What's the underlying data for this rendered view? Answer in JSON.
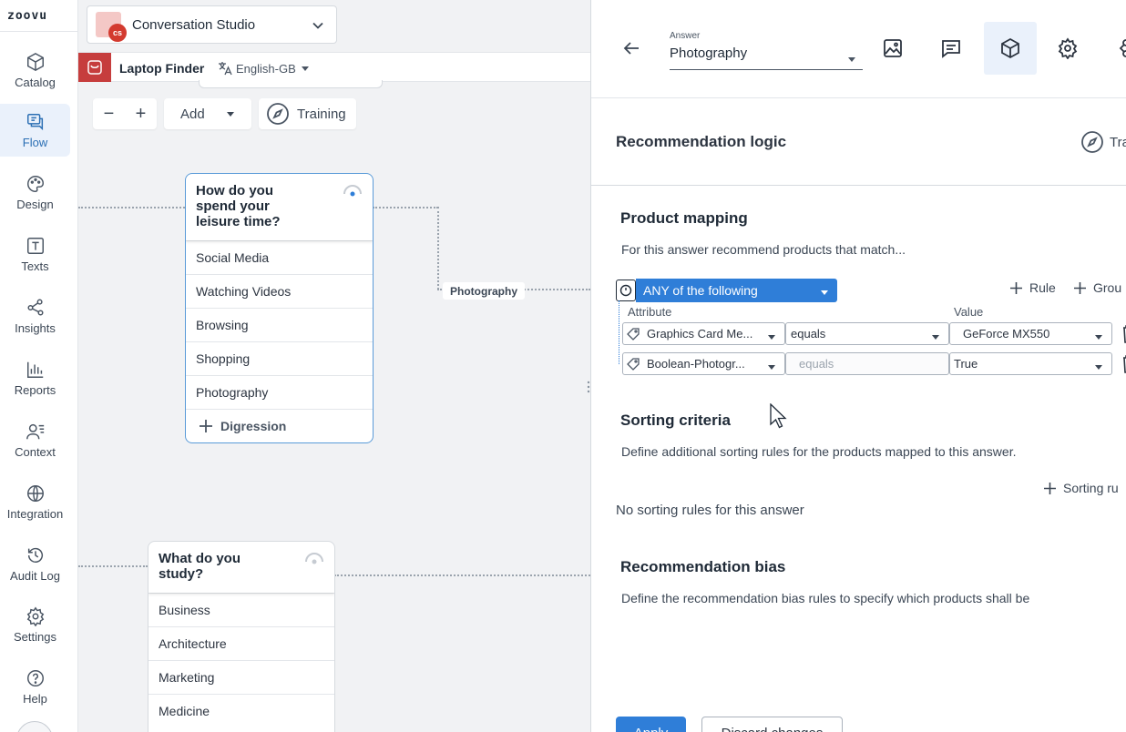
{
  "nav": {
    "logo": "zoovu",
    "items": [
      {
        "label": "Catalog",
        "icon": "cube-icon"
      },
      {
        "label": "Flow",
        "icon": "flow-icon",
        "active": true
      },
      {
        "label": "Design",
        "icon": "palette-icon"
      },
      {
        "label": "Texts",
        "icon": "text-icon"
      },
      {
        "label": "Insights",
        "icon": "share-nodes-icon"
      },
      {
        "label": "Reports",
        "icon": "bar-chart-icon"
      },
      {
        "label": "Context",
        "icon": "user-list-icon"
      },
      {
        "label": "Integration",
        "icon": "globe-icon"
      },
      {
        "label": "Audit Log",
        "icon": "history-icon"
      },
      {
        "label": "Settings",
        "icon": "gear-icon"
      },
      {
        "label": "Help",
        "icon": "help-icon"
      }
    ]
  },
  "studio": {
    "badge": "cs",
    "title": "Conversation Studio"
  },
  "subbar": {
    "finder": "Laptop Finder",
    "language": "English-GB"
  },
  "toolbar": {
    "zoom_out": "−",
    "zoom_in": "+",
    "add": "Add",
    "training": "Training"
  },
  "flow": {
    "question1": {
      "title": "How do you spend your leisure time?",
      "options": [
        "Social Media",
        "Watching Videos",
        "Browsing",
        "Shopping",
        "Photography"
      ],
      "digression": "Digression"
    },
    "edge_label": "Photography",
    "question2": {
      "title": "What do you study?",
      "options": [
        "Business",
        "Architecture",
        "Marketing",
        "Medicine"
      ]
    }
  },
  "panel": {
    "answer_label": "Answer",
    "answer_value": "Photography",
    "recommendation_logic": "Recommendation logic",
    "training_partial": "Tra",
    "product_mapping": {
      "title": "Product mapping",
      "description": "For this answer recommend products that match...",
      "match_mode": "ANY of the following",
      "add_rule": "Rule",
      "add_group": "Grou",
      "col_attribute": "Attribute",
      "col_value": "Value",
      "rules": [
        {
          "attribute": "Graphics Card Me...",
          "operator": "equals",
          "value": "GeForce MX550"
        },
        {
          "attribute": "Boolean-Photogr...",
          "operator": "equals",
          "value": "True"
        }
      ]
    },
    "sorting": {
      "title": "Sorting criteria",
      "description": "Define additional sorting rules for the products mapped to this answer.",
      "add_label": "Sorting ru",
      "empty": "No sorting rules for this answer"
    },
    "bias": {
      "title": "Recommendation bias",
      "description": "Define the recommendation bias rules to specify which products shall be"
    },
    "apply": "Apply",
    "discard": "Discard changes"
  },
  "colors": {
    "accent": "#2f7ed8",
    "brand_red": "#c63d3d",
    "active_nav_bg": "#eaf1fb",
    "canvas_bg": "#f1f2f4"
  }
}
